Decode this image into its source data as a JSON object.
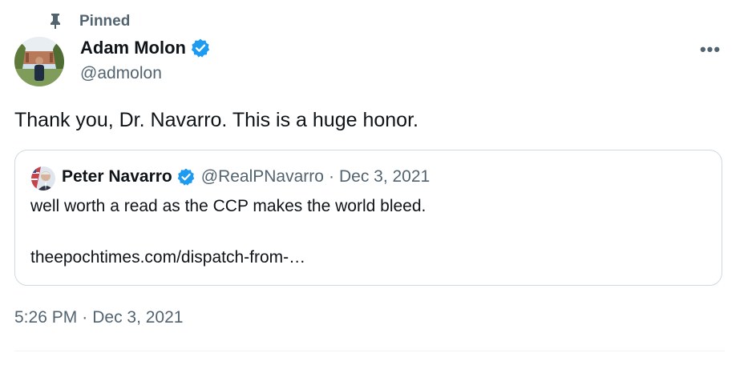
{
  "pinned": {
    "label": "Pinned",
    "icon": "pin-icon"
  },
  "author": {
    "name": "Adam Molon",
    "handle": "@admolon",
    "verified": true,
    "avatar": "avatar"
  },
  "menu": {
    "icon": "more-icon",
    "label": "•••"
  },
  "tweet": {
    "text": "Thank you, Dr. Navarro. This is a huge honor."
  },
  "quote": {
    "name": "Peter Navarro",
    "handle": "@RealPNavarro",
    "separator": "·",
    "date": "Dec 3, 2021",
    "text": "well worth a read as the CCP makes the world bleed.",
    "link": "theepochtimes.com/dispatch-from-…",
    "verified": true
  },
  "meta": {
    "time": "5:26 PM",
    "separator": "·",
    "date": "Dec 3, 2021"
  },
  "colors": {
    "verified_blue": "#1d9bf0",
    "secondary_text": "#536471",
    "border": "#cfd9de"
  }
}
